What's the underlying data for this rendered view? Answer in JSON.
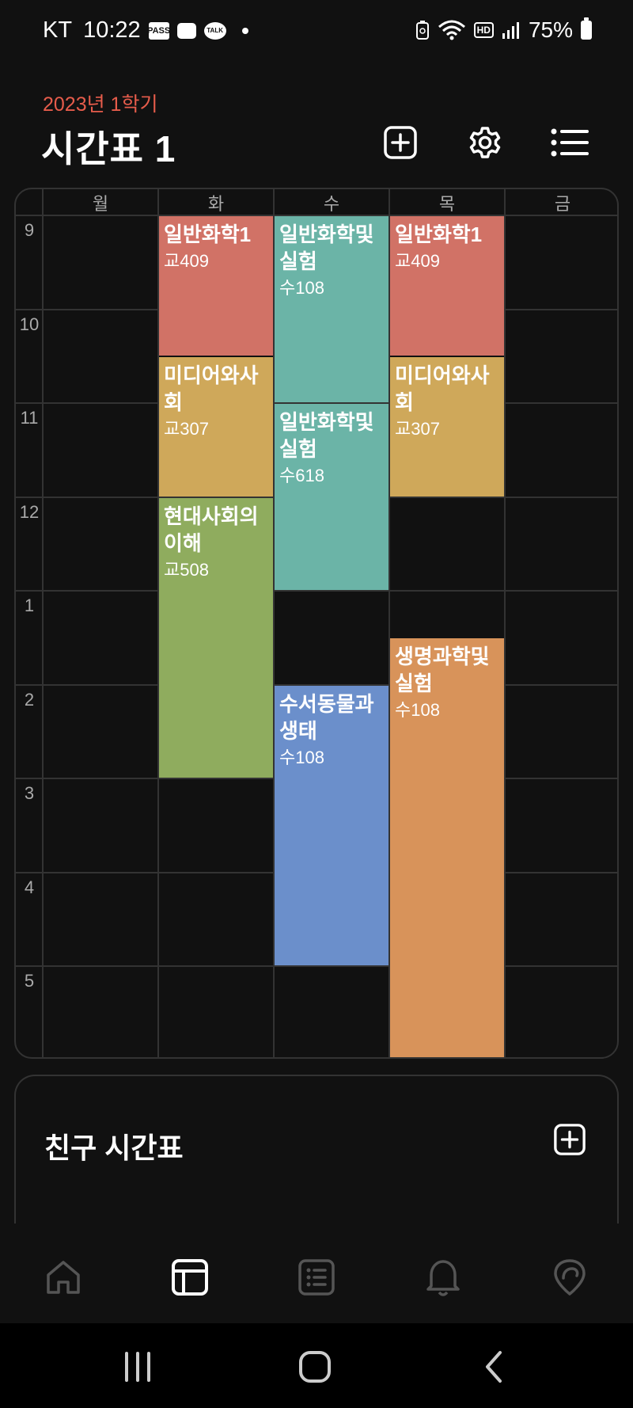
{
  "status_bar": {
    "carrier": "KT",
    "time": "10:22",
    "pass_label": "PASS",
    "talk_label": "TALK",
    "hd_label": "HD",
    "battery": "75%"
  },
  "header": {
    "semester": "2023년 1학기",
    "title": "시간표 1",
    "add_icon": "plus-square-icon",
    "settings_icon": "gear-icon",
    "list_icon": "list-icon"
  },
  "timetable": {
    "days": [
      "월",
      "화",
      "수",
      "목",
      "금"
    ],
    "hours": [
      "9",
      "10",
      "11",
      "12",
      "1",
      "2",
      "3",
      "4",
      "5"
    ],
    "classes": [
      {
        "name": "일반화학1",
        "room": "교409",
        "day": 1,
        "start": 9,
        "end": 10.5,
        "color": "#d17266"
      },
      {
        "name": "미디어와사회",
        "room": "교307",
        "day": 1,
        "start": 10.5,
        "end": 12,
        "color": "#cfa85a"
      },
      {
        "name": "현대사회의이해",
        "room": "교508",
        "day": 1,
        "start": 12,
        "end": 15,
        "color": "#8fac5e"
      },
      {
        "name": "일반화학및실험",
        "room": "수108",
        "day": 2,
        "start": 9,
        "end": 11,
        "color": "#6bb4a7"
      },
      {
        "name": "일반화학및실험",
        "room": "수618",
        "day": 2,
        "start": 11,
        "end": 13,
        "color": "#6bb4a7"
      },
      {
        "name": "수서동물과생태",
        "room": "수108",
        "day": 2,
        "start": 14,
        "end": 17,
        "color": "#6b8fcb"
      },
      {
        "name": "일반화학1",
        "room": "교409",
        "day": 3,
        "start": 9,
        "end": 10.5,
        "color": "#d17266"
      },
      {
        "name": "미디어와사회",
        "room": "교307",
        "day": 3,
        "start": 10.5,
        "end": 12,
        "color": "#cfa85a"
      },
      {
        "name": "생명과학및실험",
        "room": "수108",
        "day": 3,
        "start": 13.5,
        "end": 18,
        "color": "#d8935a"
      }
    ]
  },
  "friends": {
    "title": "친구 시간표",
    "add_icon": "plus-square-icon"
  },
  "bottom_nav": {
    "items": [
      "home-icon",
      "timetable-icon",
      "list-icon",
      "bell-icon",
      "map-pin-icon"
    ],
    "active": "timetable-icon"
  },
  "system_nav": {
    "items": [
      "recents-icon",
      "home-icon",
      "back-icon"
    ]
  },
  "colors": {
    "background": "#111111",
    "accent": "#e65c4b",
    "grid": "#333333"
  }
}
